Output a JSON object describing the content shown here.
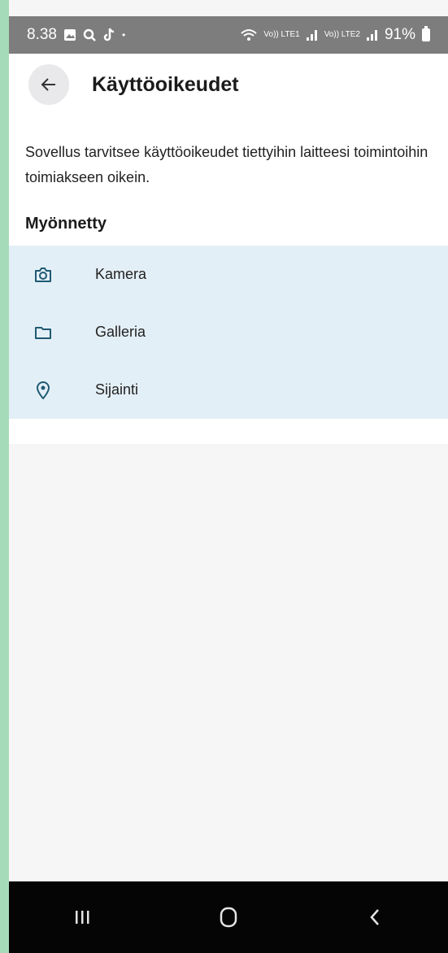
{
  "status_bar": {
    "time": "8.38",
    "sim1": "Vo)) LTE1",
    "sim2": "Vo)) LTE2",
    "battery": "91%"
  },
  "app_bar": {
    "title": "Käyttöoikeudet"
  },
  "content": {
    "description": "Sovellus tarvitsee käyttöoikeudet tiettyihin laitteesi toimintoihin toimiakseen oikein.",
    "section_title": "Myönnetty",
    "permissions": [
      {
        "label": "Kamera",
        "icon": "camera-icon"
      },
      {
        "label": "Galleria",
        "icon": "folder-icon"
      },
      {
        "label": "Sijainti",
        "icon": "location-pin-icon"
      }
    ]
  },
  "colors": {
    "accent_icon": "#1f5a73",
    "list_background": "#e3eff6",
    "status_bar": "#7d7d7d"
  }
}
